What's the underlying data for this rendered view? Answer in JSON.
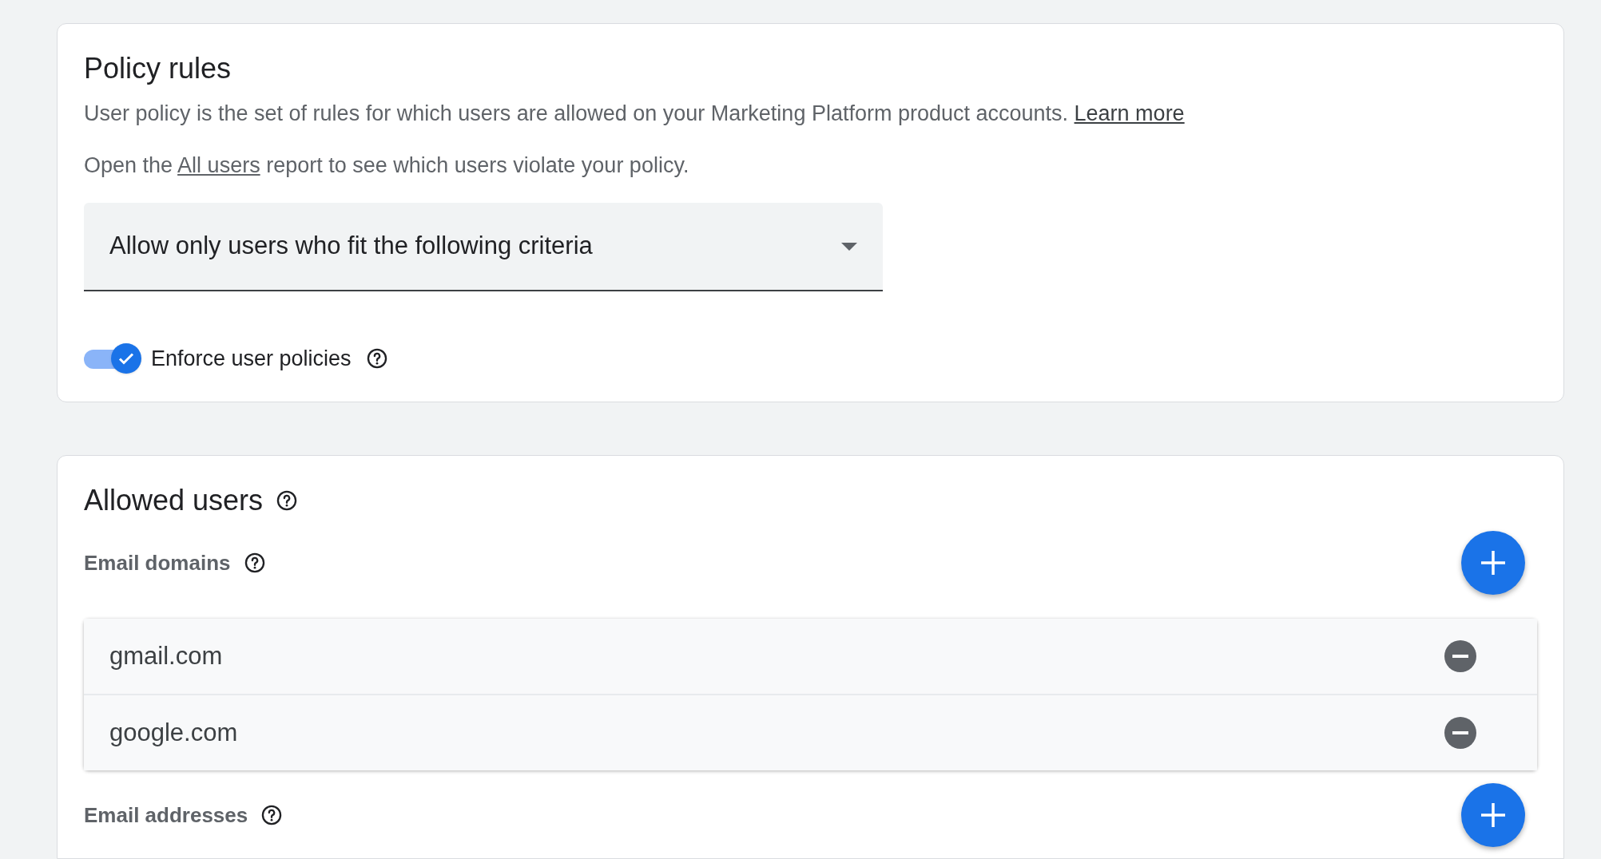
{
  "policy_rules": {
    "title": "Policy rules",
    "description": "User policy is the set of rules for which users are allowed on your Marketing Platform product accounts.",
    "learn_more": "Learn more",
    "report_prefix": "Open the",
    "report_link": "All users",
    "report_suffix": "report to see which users violate your policy.",
    "select": {
      "value": "Allow only users who fit the following criteria"
    },
    "enforce": {
      "label": "Enforce user policies",
      "on": true
    }
  },
  "allowed_users": {
    "title": "Allowed users",
    "sections": [
      {
        "label": "Email domains",
        "items": [
          "gmail.com",
          "google.com"
        ]
      },
      {
        "label": "Email addresses"
      }
    ]
  }
}
